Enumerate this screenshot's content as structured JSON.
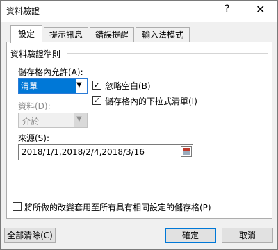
{
  "window": {
    "title": "資料驗證",
    "help_label": "?",
    "close_label": "✕"
  },
  "tabs": [
    {
      "label": "設定"
    },
    {
      "label": "提示訊息"
    },
    {
      "label": "錯誤提醒"
    },
    {
      "label": "輸入法模式"
    }
  ],
  "settings": {
    "group_title": "資料驗證準則",
    "allow_label": "儲存格內允許(A):",
    "allow_value": "清單",
    "data_label": "資料(D):",
    "data_value": "介於",
    "ignore_blank_label": "忽略空白(B)",
    "ignore_blank_mark": "✓",
    "dropdown_label": "儲存格內的下拉式清單(I)",
    "dropdown_mark": "✓",
    "source_label": "來源(S):",
    "source_value": "2018/1/1,2018/2/4,2018/3/16",
    "apply_all_label": "將所做的改變套用至所有具有相同設定的儲存格(P)"
  },
  "buttons": {
    "clear_all": "全部清除(C)",
    "ok": "確定",
    "cancel": "取消"
  },
  "icons": {
    "dropdown": "chevron-down-icon",
    "range_selector": "range-select-icon"
  }
}
